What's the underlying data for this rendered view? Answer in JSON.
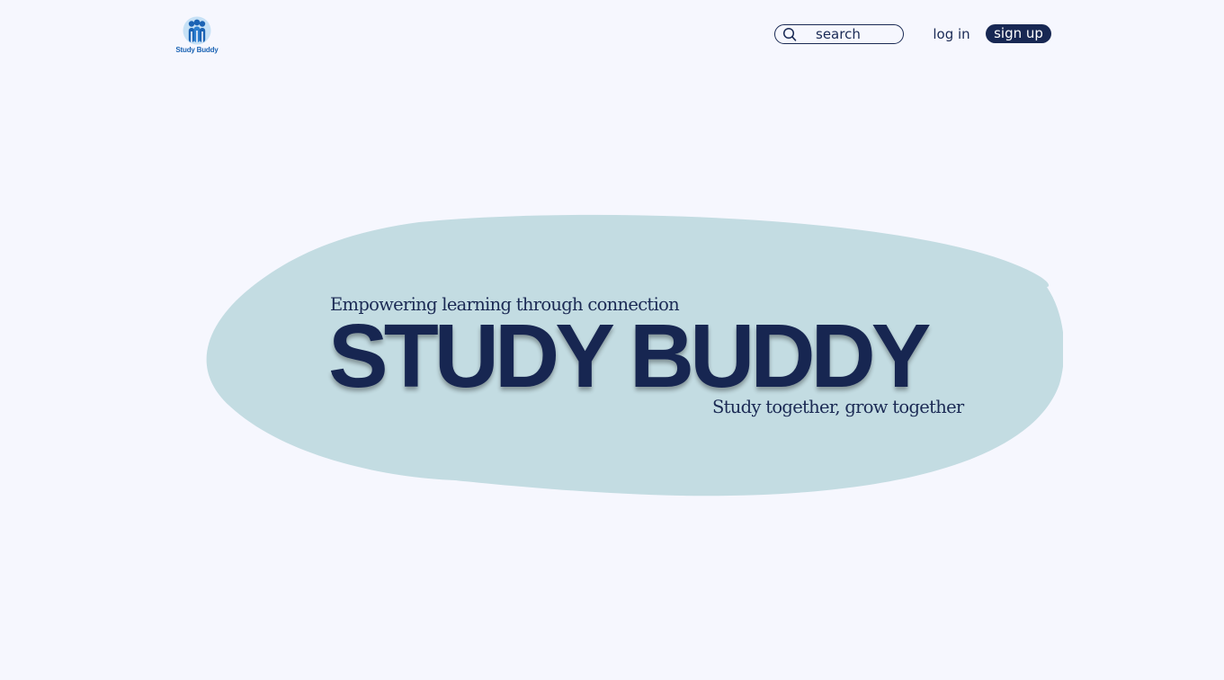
{
  "header": {
    "logo_text": "Study Buddy",
    "search": {
      "placeholder": "search",
      "value": ""
    },
    "login_label": "log in",
    "signup_label": "sign up"
  },
  "hero": {
    "tagline": "Empowering learning through connection",
    "title": "STUDY BUDDY",
    "subtitle": "Study together, grow together"
  },
  "icons": {
    "logo": "three-people-logo-icon",
    "search": "magnifier-icon"
  },
  "colors": {
    "background": "#f6f7fe",
    "blob": "#c3dce2",
    "navy": "#172651",
    "logo_blue": "#1b63b4",
    "logo_light": "#4fa8df"
  }
}
